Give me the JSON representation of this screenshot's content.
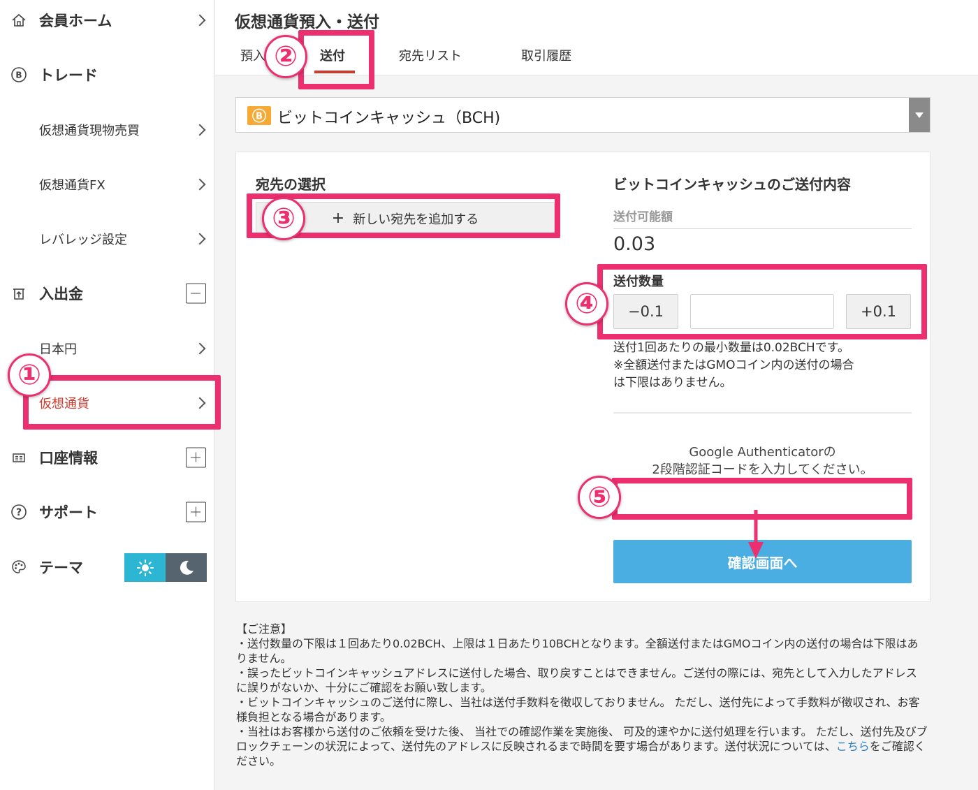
{
  "sidebar": {
    "items": [
      {
        "label": "会員ホーム",
        "icon": "home-icon",
        "control": "chevron"
      },
      {
        "label": "トレード",
        "icon": "bitcoin-icon",
        "control": "none"
      },
      {
        "label": "仮想通貨現物売買",
        "control": "chevron"
      },
      {
        "label": "仮想通貨FX",
        "control": "chevron"
      },
      {
        "label": "レバレッジ設定",
        "control": "chevron"
      },
      {
        "label": "入出金",
        "icon": "deposit-withdraw-icon",
        "control": "minus"
      },
      {
        "label": "日本円",
        "control": "chevron"
      },
      {
        "label": "仮想通貨",
        "control": "chevron",
        "active": true
      },
      {
        "label": "口座情報",
        "icon": "id-card-icon",
        "control": "plus"
      },
      {
        "label": "サポート",
        "icon": "question-icon",
        "control": "plus"
      },
      {
        "label": "テーマ",
        "icon": "palette-icon",
        "control": "theme-toggle"
      }
    ],
    "theme": {
      "light_icon": "sun-icon",
      "dark_icon": "moon-icon",
      "selected": "light"
    }
  },
  "header": {
    "title": "仮想通貨預入・送付",
    "tabs": [
      {
        "label": "預入"
      },
      {
        "label": "送付",
        "active": true
      },
      {
        "label": "宛先リスト"
      },
      {
        "label": "取引履歴"
      }
    ]
  },
  "coin_select": {
    "value": "ビットコインキャッシュ（BCH)",
    "icon": "bitcoin-cash-icon"
  },
  "destination": {
    "heading": "宛先の選択",
    "add_button": "新しい宛先を追加する",
    "add_icon": "+"
  },
  "send": {
    "heading": "ビットコインキャッシュのご送付内容",
    "available_label": "送付可能額",
    "available_value": "0.03",
    "quantity_label": "送付数量",
    "minus_button": "−0.1",
    "plus_button": "+0.1",
    "quantity_value": "",
    "note_lines": [
      "送付1回あたりの最小数量は0.02BCHです。",
      "※全額送付またはGMOコイン内の送付の場合",
      "は下限はありません。"
    ],
    "auth_lines": [
      "Google Authenticatorの",
      "2段階認証コードを入力してください。"
    ],
    "auth_value": "",
    "confirm_button": "確認画面へ"
  },
  "notes": {
    "heading": "【ご注意】",
    "lines": [
      "・送付数量の下限は１回あたり0.02BCH、上限は１日あたり10BCHとなります。全額送付またはGMOコイン内の送付の場合は下限はありません。",
      "・誤ったビットコインキャッシュアドレスに送付した場合、取り戻すことはできません。ご送付の際には、宛先として入力したアドレスに誤りがないか、十分にご確認をお願い致します。",
      "・ビットコインキャッシュのご送付に際し、当社は送付手数料を徴収しておりません。 ただし、送付先によって手数料が徴収され、お客様負担となる場合があります。",
      "・当社はお客様から送付のご依頼を受けた後、 当社での確認作業を実施後、 可及的速やかに送付処理を行います。 ただし、送付先及びブロックチェーンの状況によって、送付先のアドレスに反映されるまで時間を要す場合があります。送付状況については、"
    ],
    "link_text": "こちら",
    "tail_text": "をご確認ください。"
  },
  "annotations": {
    "badges": [
      "①",
      "②",
      "③",
      "④",
      "⑤"
    ],
    "color": "#ec2f6e"
  },
  "colors": {
    "accent_red": "#d0392b",
    "confirm_blue": "#4aaee3",
    "theme_light": "#2cb6d3",
    "theme_dark": "#566470",
    "bch_orange": "#f7a934"
  }
}
